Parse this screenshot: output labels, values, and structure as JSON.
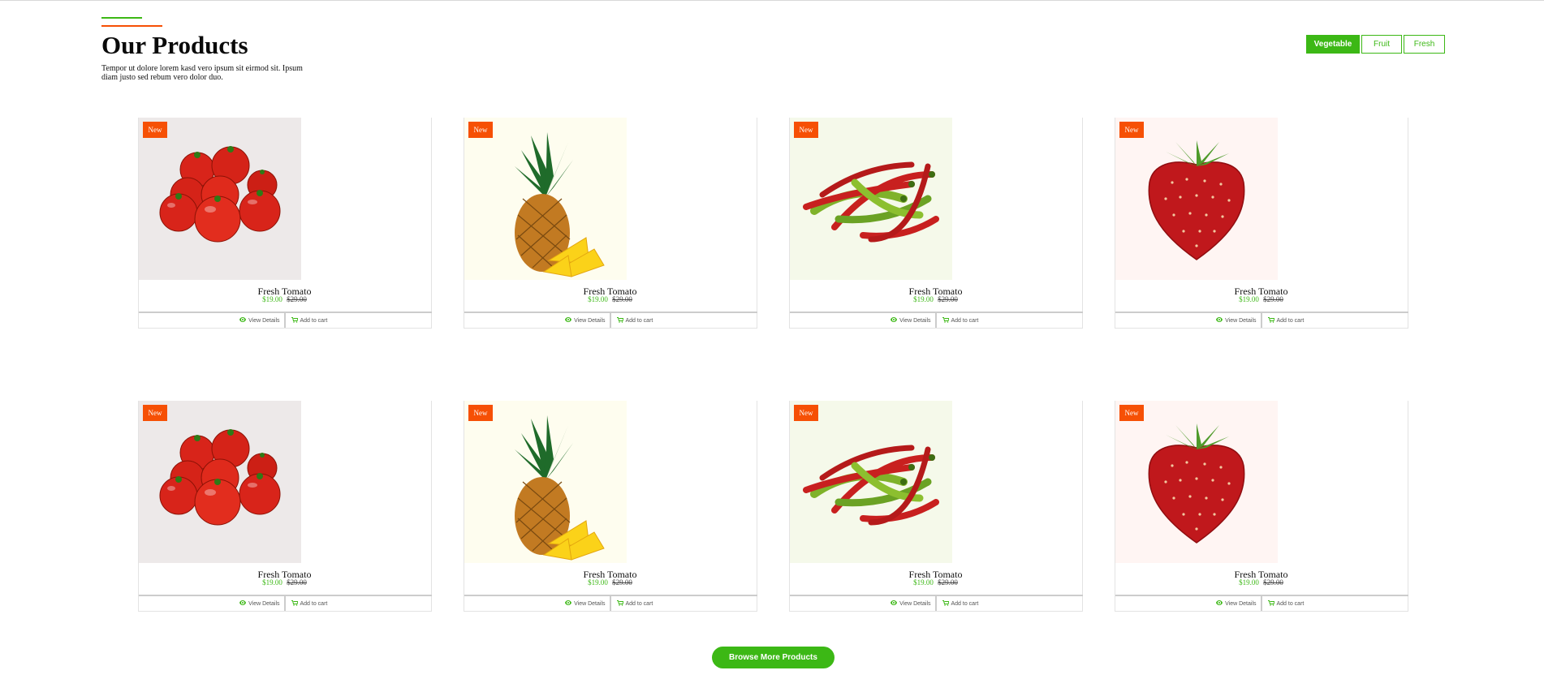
{
  "header": {
    "title": "Our Products",
    "subtitle": "Tempor ut dolore lorem kasd vero ipsum sit eirmod sit. Ipsum diam justo sed rebum vero dolor duo."
  },
  "filters": [
    {
      "label": "Vegetable",
      "active": true
    },
    {
      "label": "Fruit",
      "active": false
    },
    {
      "label": "Fresh",
      "active": false
    }
  ],
  "products": [
    {
      "badge": "New",
      "name": "Fresh Tomato",
      "price": "$19.00",
      "old_price": "$29.00",
      "image": "tomato",
      "bg": "#ede9e9"
    },
    {
      "badge": "New",
      "name": "Fresh Tomato",
      "price": "$19.00",
      "old_price": "$29.00",
      "image": "pineapple",
      "bg": "#fefdef"
    },
    {
      "badge": "New",
      "name": "Fresh Tomato",
      "price": "$19.00",
      "old_price": "$29.00",
      "image": "chili",
      "bg": "#f5f9ea"
    },
    {
      "badge": "New",
      "name": "Fresh Tomato",
      "price": "$19.00",
      "old_price": "$29.00",
      "image": "strawberry",
      "bg": "#fff5f3"
    },
    {
      "badge": "New",
      "name": "Fresh Tomato",
      "price": "$19.00",
      "old_price": "$29.00",
      "image": "tomato",
      "bg": "#ede9e9"
    },
    {
      "badge": "New",
      "name": "Fresh Tomato",
      "price": "$19.00",
      "old_price": "$29.00",
      "image": "pineapple",
      "bg": "#fefdef"
    },
    {
      "badge": "New",
      "name": "Fresh Tomato",
      "price": "$19.00",
      "old_price": "$29.00",
      "image": "chili",
      "bg": "#f5f9ea"
    },
    {
      "badge": "New",
      "name": "Fresh Tomato",
      "price": "$19.00",
      "old_price": "$29.00",
      "image": "strawberry",
      "bg": "#fff5f3"
    }
  ],
  "actions": {
    "view_details": "View Details",
    "add_to_cart": "Add to cart"
  },
  "browse_button": "Browse More Products",
  "colors": {
    "accent": "#3cb815",
    "badge": "#f65005"
  }
}
